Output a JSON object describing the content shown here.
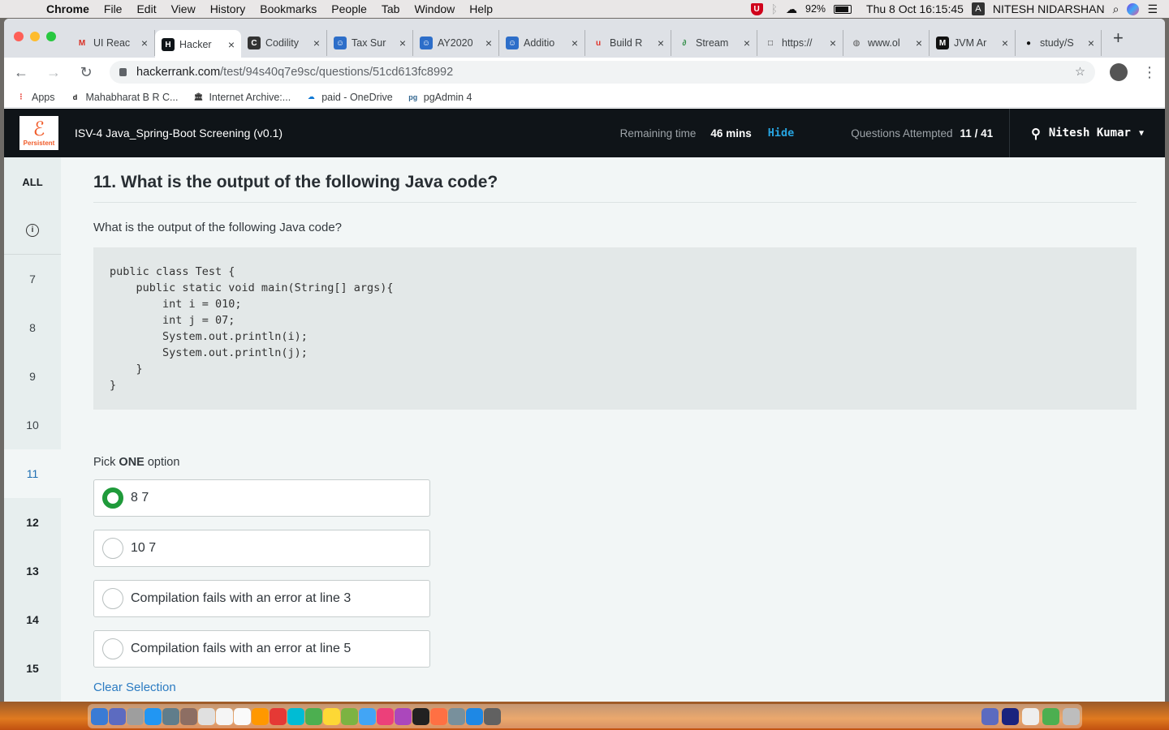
{
  "menubar": {
    "app": "Chrome",
    "items": [
      "File",
      "Edit",
      "View",
      "History",
      "Bookmarks",
      "People",
      "Tab",
      "Window",
      "Help"
    ],
    "battery": "92%",
    "datetime": "Thu 8 Oct  16:15:45",
    "input_source": "A",
    "user": "NITESH NIDARSHAN"
  },
  "tabs": [
    {
      "label": "UI Reac",
      "icon": "gmail-icon",
      "fav": "M",
      "color": "#d93025",
      "bg": "transparent"
    },
    {
      "label": "Hacker",
      "icon": "hackerrank-icon",
      "fav": "H",
      "color": "#fff",
      "bg": "#0f1418",
      "active": true
    },
    {
      "label": "Codility",
      "icon": "codility-icon",
      "fav": "C",
      "color": "#fff",
      "bg": "#333"
    },
    {
      "label": "Tax Sur",
      "icon": "people-icon",
      "fav": "☺",
      "color": "#fff",
      "bg": "#2d6ec9"
    },
    {
      "label": "AY2020",
      "icon": "people-icon",
      "fav": "☺",
      "color": "#fff",
      "bg": "#2d6ec9"
    },
    {
      "label": "Additio",
      "icon": "people-icon",
      "fav": "☺",
      "color": "#fff",
      "bg": "#2d6ec9"
    },
    {
      "label": "Build R",
      "icon": "udemy-icon",
      "fav": "u",
      "color": "#e0332a",
      "bg": "transparent"
    },
    {
      "label": "Stream",
      "icon": "geeksforgeeks-icon",
      "fav": "∂",
      "color": "#2f8d46",
      "bg": "transparent"
    },
    {
      "label": "https://",
      "icon": "page-icon",
      "fav": "□",
      "color": "#333",
      "bg": "transparent"
    },
    {
      "label": "www.ol",
      "icon": "openlibrary-icon",
      "fav": "◍",
      "color": "#555",
      "bg": "transparent"
    },
    {
      "label": "JVM Ar",
      "icon": "medium-icon",
      "fav": "M",
      "color": "#fff",
      "bg": "#111"
    },
    {
      "label": "study/S",
      "icon": "github-icon",
      "fav": "●",
      "color": "#111",
      "bg": "transparent"
    }
  ],
  "omnibox": {
    "host": "hackerrank.com",
    "path": "/test/94s40q7e9sc/questions/51cd613fc8992"
  },
  "bookmarks": [
    {
      "label": "Apps",
      "icon": "apps-grid-icon",
      "fav": "⋮",
      "color": "#e8453c"
    },
    {
      "label": "Mahabharat B R C...",
      "icon": "dailymotion-icon",
      "fav": "d",
      "color": "#111"
    },
    {
      "label": "Internet Archive:...",
      "icon": "archive-icon",
      "fav": "🏛",
      "color": "#333"
    },
    {
      "label": "paid - OneDrive",
      "icon": "onedrive-icon",
      "fav": "☁",
      "color": "#0f78d4"
    },
    {
      "label": "pgAdmin 4",
      "icon": "pgadmin-icon",
      "fav": "pg",
      "color": "#326690"
    }
  ],
  "header": {
    "logo_text": "Persistent",
    "test_name": "ISV-4 Java_Spring-Boot Screening (v0.1)",
    "remaining_label": "Remaining time",
    "remaining_value": "46 mins",
    "hide_label": "Hide",
    "attempted_label": "Questions Attempted",
    "attempted_value": "11 / 41",
    "user_name": "Nitesh Kumar"
  },
  "qnav": {
    "all_label": "ALL",
    "items": [
      {
        "num": "7",
        "state": "normal"
      },
      {
        "num": "8",
        "state": "normal"
      },
      {
        "num": "9",
        "state": "normal"
      },
      {
        "num": "10",
        "state": "normal"
      },
      {
        "num": "11",
        "state": "current"
      },
      {
        "num": "12",
        "state": "bold"
      },
      {
        "num": "13",
        "state": "bold"
      },
      {
        "num": "14",
        "state": "bold"
      },
      {
        "num": "15",
        "state": "bold"
      }
    ]
  },
  "question": {
    "title": "11. What is the output of the following Java code?",
    "text": "What is the output of the following Java code?",
    "code": "public class Test {\n    public static void main(String[] args){\n        int i = 010;\n        int j = 07;\n        System.out.println(i);\n        System.out.println(j);\n    }\n}",
    "pick_prefix": "Pick ",
    "pick_bold": "ONE",
    "pick_suffix": " option",
    "options": [
      {
        "label": "8 7",
        "selected": true
      },
      {
        "label": "10 7",
        "selected": false
      },
      {
        "label": "Compilation fails with an error at line 3",
        "selected": false
      },
      {
        "label": "Compilation fails with an error at line 5",
        "selected": false
      }
    ],
    "clear_label": "Clear Selection"
  },
  "colors": {
    "accent_blue": "#27a4e0",
    "selected_green": "#1f9a3a",
    "header_bg": "#0f1418"
  }
}
